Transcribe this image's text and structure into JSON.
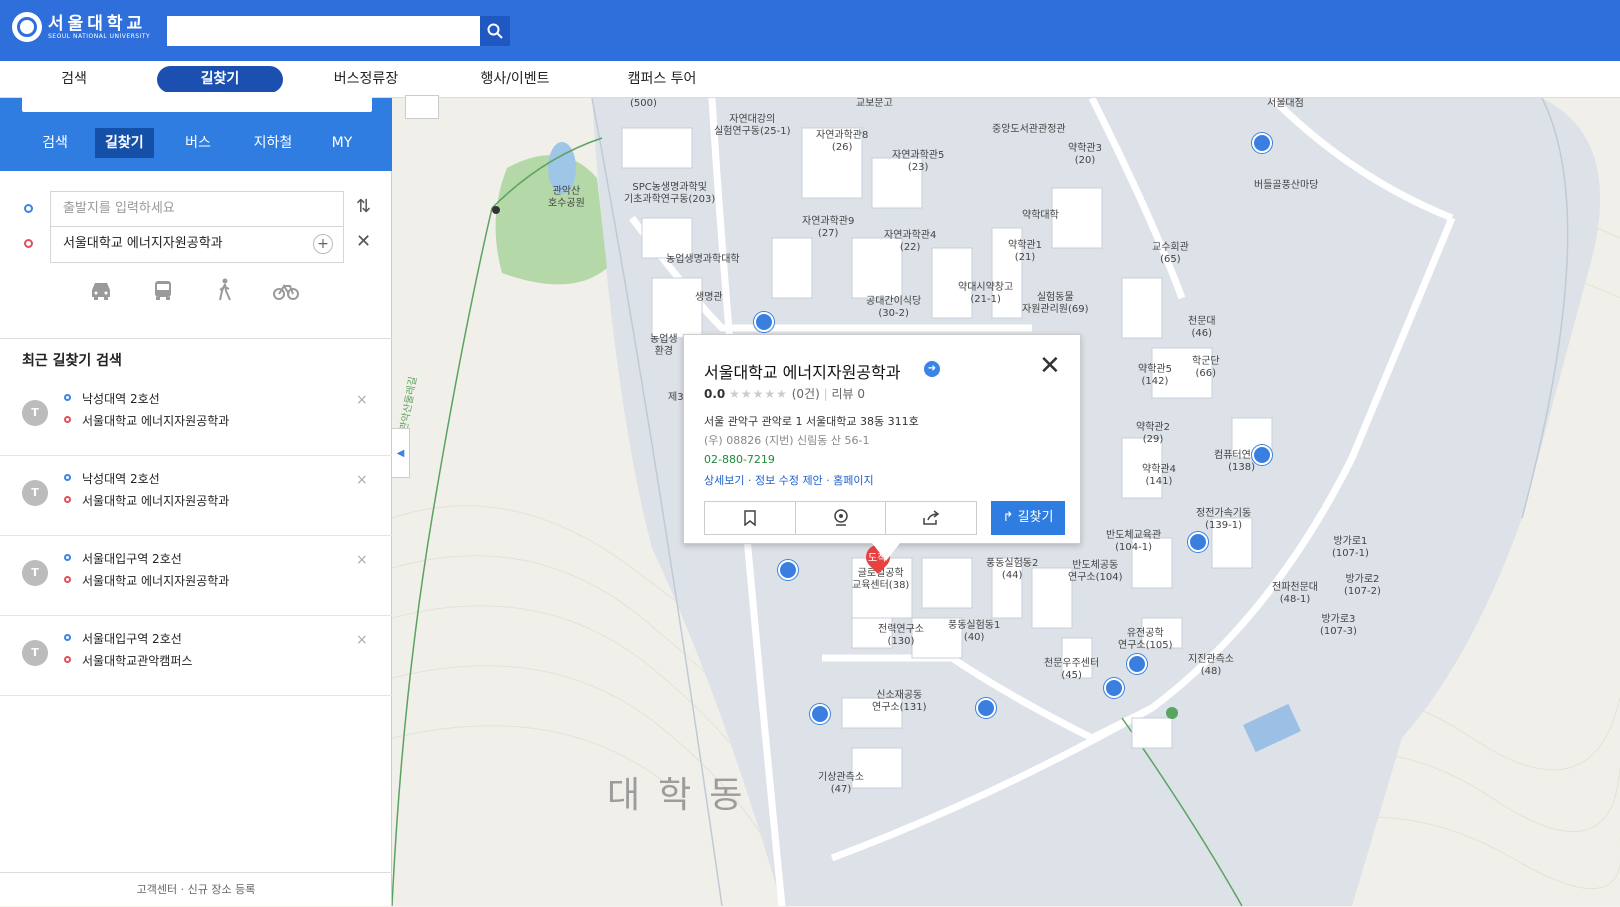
{
  "header": {
    "logo_kor": "서울대학교",
    "logo_eng": "SEOUL NATIONAL UNIVERSITY",
    "search_value": "",
    "search_icon": "search-icon"
  },
  "nav": {
    "items": [
      "검색",
      "길찾기",
      "버스정류장",
      "행사/이벤트",
      "캠퍼스 투어"
    ],
    "active": "길찾기"
  },
  "panel": {
    "tabs": [
      "검색",
      "길찾기",
      "버스",
      "지하철",
      "MY"
    ],
    "active_tab": "길찾기",
    "from_placeholder": "출발지를 입력하세요",
    "to_value": "서울대학교 에너지자원공학과",
    "plus_label": "+",
    "swap_icon": "swap-icon",
    "clear_icon": "close-icon",
    "modes": [
      "car-icon",
      "bus-icon",
      "walk-icon",
      "bike-icon"
    ],
    "recent_title": "최근 길찾기 검색",
    "recent": [
      {
        "from": "낙성대역 2호선",
        "to": "서울대학교 에너지자원공학과",
        "icon": "T"
      },
      {
        "from": "낙성대역 2호선",
        "to": "서울대학교 에너지자원공학과",
        "icon": "T"
      },
      {
        "from": "서울대입구역 2호선",
        "to": "서울대학교 에너지자원공학과",
        "icon": "T"
      },
      {
        "from": "서울대입구역 2호선",
        "to": "서울대학교관악캠퍼스",
        "icon": "T"
      }
    ],
    "delete_label": "×",
    "footer": "고객센터 · 신규 장소 등록"
  },
  "popup": {
    "title": "서울대학교 에너지자원공학과",
    "rating": "0.0",
    "stars": "★★★★★",
    "rating_count": "(0건)",
    "reviews": "리뷰 0",
    "address": "서울 관악구 관악로 1 서울대학교 38동 311호",
    "zip": "(우) 08826  (지번) 신림동 산 56-1",
    "phone": "02-880-7219",
    "links": "상세보기 · 정보 수정 제안 · 홈페이지",
    "go_label": "길찾기",
    "close_label": "✕",
    "marker_label": "도착"
  },
  "map": {
    "area": "대학동",
    "labels": [
      {
        "t": "(500)"
      },
      {
        "t": "자연대강의\n실험연구동(25-1)"
      },
      {
        "t": "교보문고"
      },
      {
        "t": "자연과학관8\n(26)"
      },
      {
        "t": "자연과학관5\n(23)"
      },
      {
        "t": "중앙도서관관정관"
      },
      {
        "t": "약학관3\n(20)"
      },
      {
        "t": "서울대점"
      },
      {
        "t": "버들골풍산마당"
      },
      {
        "t": "관악산\n호수공원"
      },
      {
        "t": "SPC농생명과학및\n기초과학연구동(203)"
      },
      {
        "t": "자연과학관9\n(27)"
      },
      {
        "t": "자연과학관4\n(22)"
      },
      {
        "t": "약학대학"
      },
      {
        "t": "약학관1\n(21)"
      },
      {
        "t": "교수회관\n(65)"
      },
      {
        "t": "농업생명과학대학"
      },
      {
        "t": "생명관"
      },
      {
        "t": "공대간이식당\n(30-2)"
      },
      {
        "t": "약대시약창고\n(21-1)"
      },
      {
        "t": "실험동물\n자원관리원(69)"
      },
      {
        "t": "천문대\n(46)"
      },
      {
        "t": "약학관5\n(142)"
      },
      {
        "t": "학군단\n(66)"
      },
      {
        "t": "약학관2\n(29)"
      },
      {
        "t": "컴퓨터연구소\n(138)"
      },
      {
        "t": "약학관4\n(141)"
      },
      {
        "t": "정전가속기동\n(139-1)"
      },
      {
        "t": "반도체교육관\n(104-1)"
      },
      {
        "t": "반도체공동\n연구소(104)"
      },
      {
        "t": "방가로1\n(107-1)"
      },
      {
        "t": "방가로2\n(107-2)"
      },
      {
        "t": "전파천문대\n(48-1)"
      },
      {
        "t": "방가로3\n(107-3)"
      },
      {
        "t": "글로벌공학\n교육센터(38)"
      },
      {
        "t": "풍동실험동2\n(44)"
      },
      {
        "t": "전력연구소\n(130)"
      },
      {
        "t": "풍동실험동1\n(40)"
      },
      {
        "t": "유전공학\n연구소(105)"
      },
      {
        "t": "지진관측소\n(48)"
      },
      {
        "t": "천문우주센터\n(45)"
      },
      {
        "t": "신소재공동\n연구소(131)"
      },
      {
        "t": "기상관측소\n(47)"
      },
      {
        "t": "농업생\n환경"
      },
      {
        "t": "제3"
      },
      {
        "t": "관악산둘레길"
      }
    ]
  },
  "colors": {
    "brand": "#2f6fdb",
    "panel_head": "#2f7de1",
    "active_nav": "#1b4fb0",
    "bus_stop": "#3a7fe0",
    "marker": "#e94040",
    "phone": "#1f8a3a",
    "link": "#1f5fcf"
  }
}
